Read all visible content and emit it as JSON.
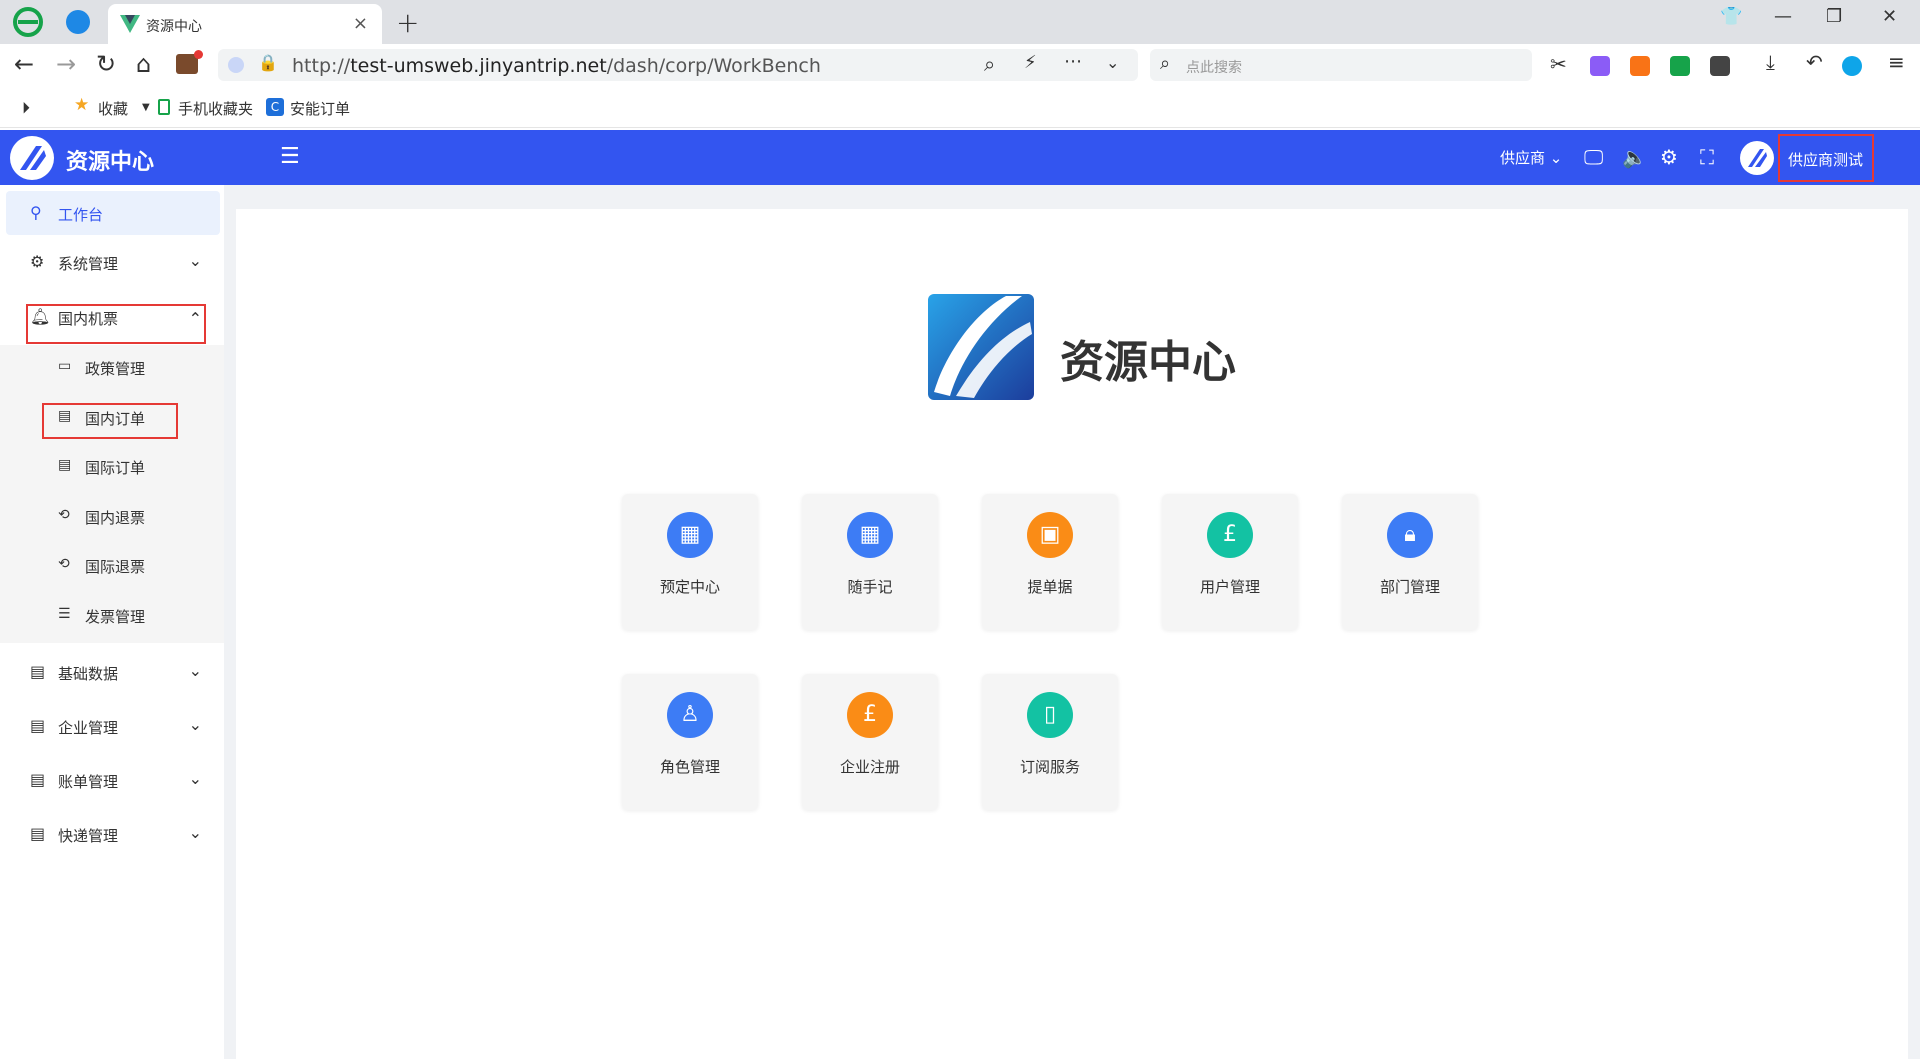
{
  "browser": {
    "tab_title": "资源中心",
    "tab_close": "×",
    "new_tab": "+",
    "url_scheme": "http://",
    "url_host": "test-umsweb.jinyantrip.net",
    "url_path": "/dash/corp/WorkBench",
    "search_placeholder": "点此搜索",
    "bookmarks": {
      "favorites": "收藏",
      "mobile": "手机收藏夹",
      "anneng": "安能订单"
    }
  },
  "header": {
    "app_title": "资源中心",
    "role_select": "供应商",
    "user_name": "供应商测试"
  },
  "sidebar": {
    "workbench": "工作台",
    "system": "系统管理",
    "domestic_air": "国内机票",
    "sub": {
      "policy": "政策管理",
      "domestic_order": "国内订单",
      "intl_order": "国际订单",
      "domestic_refund": "国内退票",
      "intl_refund": "国际退票",
      "invoice": "发票管理"
    },
    "basic_data": "基础数据",
    "enterprise": "企业管理",
    "billing": "账单管理",
    "express": "快递管理"
  },
  "main": {
    "brand_title": "资源中心",
    "tiles": {
      "booking": "预定中心",
      "notes": "随手记",
      "submit": "提单据",
      "users": "用户管理",
      "departments": "部门管理",
      "roles": "角色管理",
      "enterprise_reg": "企业注册",
      "subscription": "订阅服务"
    }
  },
  "colors": {
    "header_blue": "#3355f0",
    "tile_blue": "#3d7cf5",
    "tile_orange": "#fa8c16",
    "tile_teal": "#13c2a3",
    "highlight_red": "#e53935"
  }
}
